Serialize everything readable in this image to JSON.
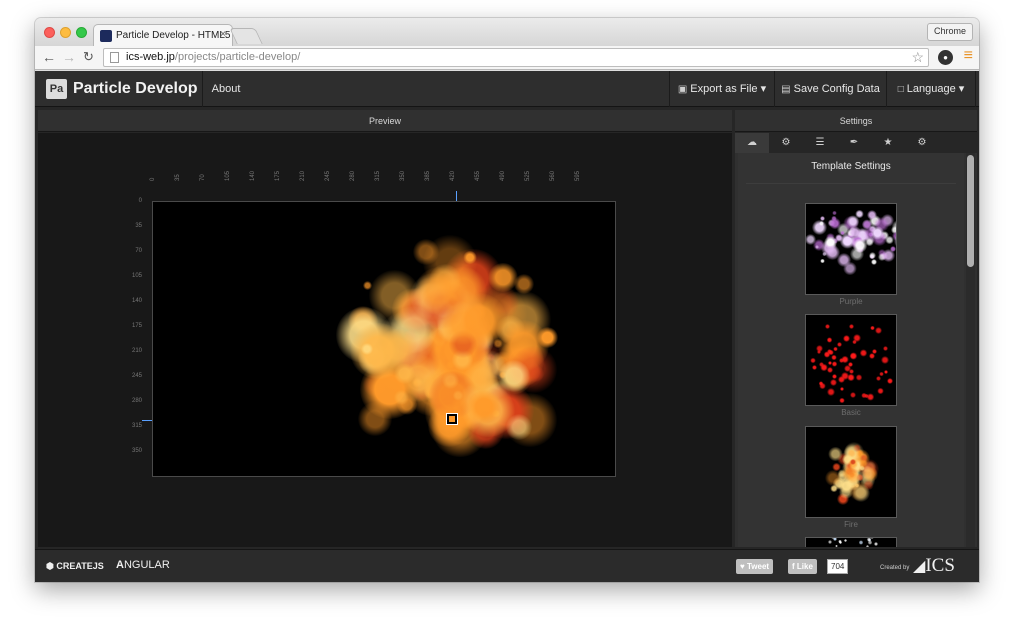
{
  "browser": {
    "tab_title": "Particle Develop - HTML5",
    "tab_close": "×",
    "profile_button": "Chrome",
    "url_host": "ics-web.jp",
    "url_path": "/projects/particle-develop/"
  },
  "app": {
    "logo_text": "Pa",
    "brand": "Particle Develop",
    "nav": {
      "about": "About",
      "export": "Export as File",
      "save": "Save Config Data",
      "language": "Language"
    },
    "preview_title": "Preview",
    "settings_title": "Settings",
    "ruler_x": [
      "0",
      "35",
      "70",
      "105",
      "140",
      "175",
      "210",
      "245",
      "280",
      "315",
      "350",
      "385",
      "420",
      "455",
      "490",
      "525",
      "560",
      "595"
    ],
    "ruler_y": [
      "0",
      "35",
      "70",
      "105",
      "140",
      "175",
      "210",
      "245",
      "280",
      "315",
      "350"
    ],
    "settings": {
      "section_title": "Template Settings",
      "templates": [
        {
          "label": "Purple"
        },
        {
          "label": "Basic"
        },
        {
          "label": "Fire"
        }
      ]
    },
    "footer": {
      "createjs": "CREATEJS",
      "angular": "NGULAR",
      "tweet": "Tweet",
      "like": "Like",
      "like_count": "704",
      "created_by": "Created by",
      "ics": "ICS"
    }
  },
  "colors": {
    "accent_marker": "#5aa0ff",
    "fire_core": "#ffe08a",
    "fire_mid": "#ff9a2a",
    "fire_outer": "#d8401a",
    "basic_red": "#ff1a1a",
    "purple": "#e0b8f0"
  }
}
